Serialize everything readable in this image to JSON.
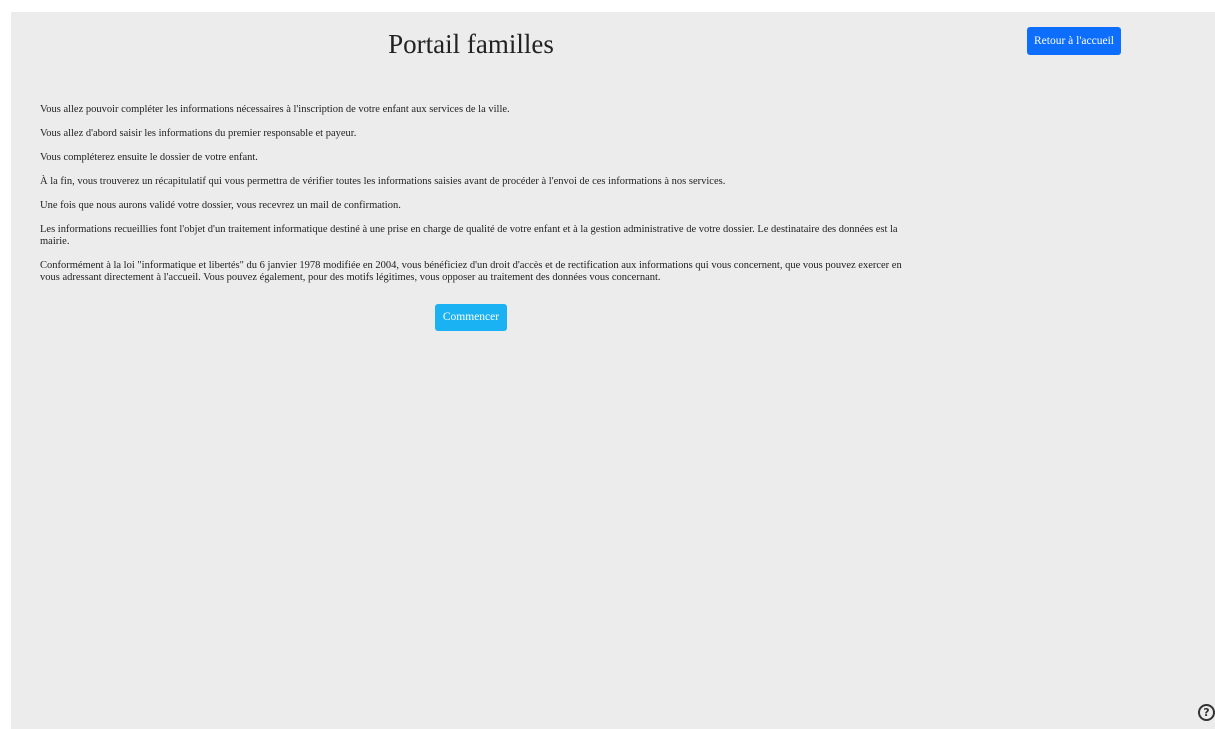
{
  "header": {
    "title": "Portail familles",
    "home_button_label": "Retour à l'accueil"
  },
  "intro": {
    "paragraphs": [
      "Vous allez pouvoir compléter les informations nécessaires à l'inscription de votre enfant aux services de la ville.",
      "Vous allez d'abord saisir les informations du premier responsable et payeur.",
      "Vous compléterez ensuite le dossier de votre enfant.",
      "À la fin, vous trouverez un récapitulatif qui vous permettra de vérifier toutes les informations saisies avant de procéder à l'envoi de ces informations à nos services.",
      "Une fois que nous aurons validé votre dossier, vous recevrez un mail de confirmation.",
      "Les informations recueillies font l'objet d'un traitement informatique destiné à une prise en charge de qualité de votre enfant et à la gestion administrative de votre dossier. Le destinataire des données est la mairie.",
      "Conformément à la loi \"informatique et libertés\" du 6 janvier 1978 modifiée en 2004, vous bénéficiez d'un droit d'accès et de rectification aux informations qui vous concernent, que vous pouvez exercer en vous adressant directement à l'accueil. Vous pouvez également, pour des motifs légitimes, vous opposer au traitement des données vous concernant."
    ]
  },
  "actions": {
    "start_button_label": "Commencer"
  },
  "help": {
    "icon": "help-circle-icon",
    "glyph": "?"
  },
  "colors": {
    "background": "#ececec",
    "primary_button": "#0d6efd",
    "start_button": "#1ab2f2"
  }
}
